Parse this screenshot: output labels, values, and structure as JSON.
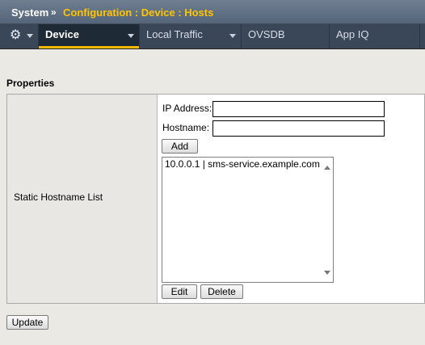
{
  "breadcrumb": {
    "root": "System",
    "separator": "»",
    "path": "Configuration : Device : Hosts"
  },
  "tabs": [
    {
      "label": "Device",
      "active": true
    },
    {
      "label": "Local Traffic",
      "active": false
    },
    {
      "label": "OVSDB",
      "active": false
    },
    {
      "label": "App IQ",
      "active": false
    }
  ],
  "icons": {
    "gear": "gear-icon",
    "menu_caret": "chevron-down-icon"
  },
  "colors": {
    "accent": "#f5b800",
    "breadcrumb_path": "#ffc400",
    "tab_bar": "#3a4758"
  },
  "properties": {
    "title": "Properties",
    "row_label": "Static Hostname List",
    "ip_label": "IP Address:",
    "ip_value": "",
    "hostname_label": "Hostname:",
    "hostname_value": "",
    "add_label": "Add",
    "entries": [
      "10.0.0.1 | sms-service.example.com"
    ],
    "edit_label": "Edit",
    "delete_label": "Delete"
  },
  "update_label": "Update"
}
